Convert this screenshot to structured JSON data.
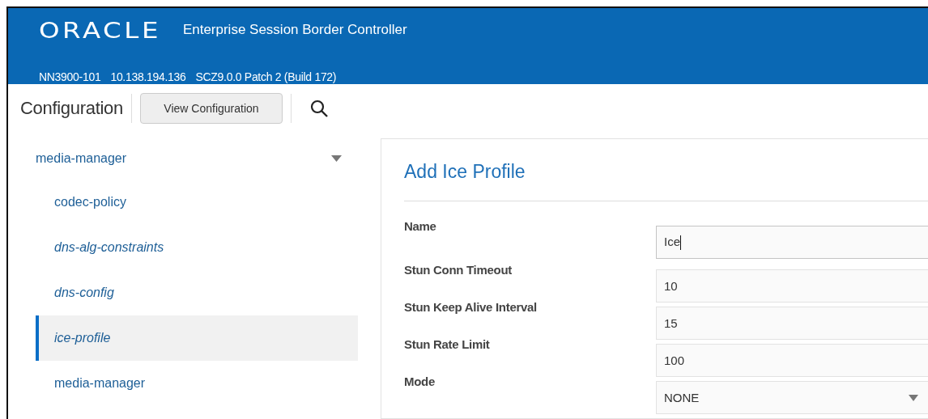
{
  "header": {
    "logo": "ORACLE",
    "title": "Enterprise Session Border Controller",
    "info": [
      "NN3900-101",
      "10.138.194.136",
      "SCZ9.0.0 Patch 2 (Build 172)"
    ]
  },
  "toolbar": {
    "title": "Configuration",
    "button": "View Configuration"
  },
  "sidebar": {
    "group": {
      "label": "media-manager",
      "expanded": true
    },
    "items": [
      {
        "label": "codec-policy",
        "italic": false,
        "selected": false
      },
      {
        "label": "dns-alg-constraints",
        "italic": true,
        "selected": false
      },
      {
        "label": "dns-config",
        "italic": true,
        "selected": false
      },
      {
        "label": "ice-profile",
        "italic": true,
        "selected": true
      },
      {
        "label": "media-manager",
        "italic": false,
        "selected": false
      }
    ]
  },
  "form": {
    "title": "Add Ice Profile",
    "fields": [
      {
        "label": "Name",
        "kind": "text",
        "value": "Ice",
        "focused": true
      },
      {
        "label": "Stun Conn Timeout",
        "kind": "text",
        "value": "10",
        "focused": false
      },
      {
        "label": "Stun Keep Alive Interval",
        "kind": "text",
        "value": "15",
        "focused": false
      },
      {
        "label": "Stun Rate Limit",
        "kind": "text",
        "value": "100",
        "focused": false
      },
      {
        "label": "Mode",
        "kind": "select",
        "value": "NONE",
        "focused": false
      }
    ]
  }
}
